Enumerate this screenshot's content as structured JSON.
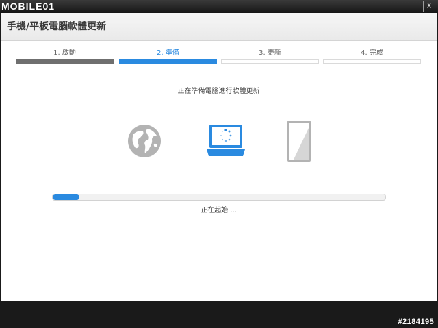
{
  "titlebar": {
    "logo_text": "MOBILE01",
    "close_label": "X"
  },
  "header": {
    "title": "手機/平板電腦軟體更新"
  },
  "steps": [
    {
      "label": "1. 啟動",
      "state": "done"
    },
    {
      "label": "2. 準備",
      "state": "active"
    },
    {
      "label": "3. 更新",
      "state": "pending"
    },
    {
      "label": "4. 完成",
      "state": "pending"
    }
  ],
  "status": {
    "top_text": "正在準備電腦進行軟體更新",
    "bottom_text": "正在起始 ...",
    "progress_fraction": 0.08
  },
  "icons": {
    "source": "globe-icon",
    "computer": "laptop-icon",
    "device": "phone-icon"
  },
  "colors": {
    "accent": "#2a8ae0",
    "done": "#6f6f6f",
    "icon_gray": "#b3b3b3"
  },
  "watermark": "#2184195"
}
